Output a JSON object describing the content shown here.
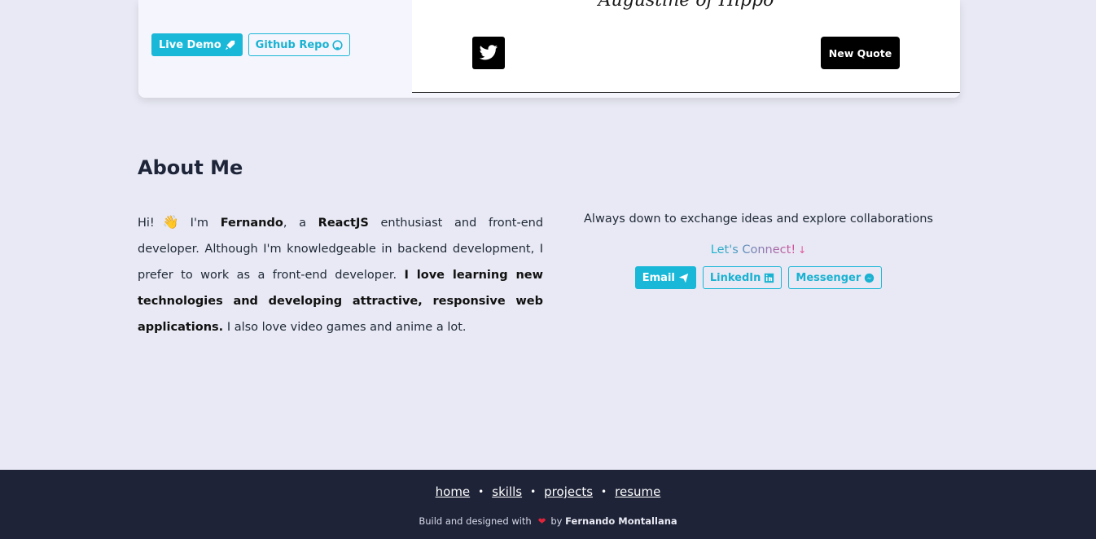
{
  "project_card": {
    "live_demo_label": "Live Demo",
    "github_label": "Github Repo",
    "quote_author": "Augustine of Hippo",
    "new_quote_label": "New Quote"
  },
  "about": {
    "title": "About Me",
    "intro_hi": "Hi!",
    "wave_emoji": "👋",
    "intro_im": "I'm",
    "name": "Fernando",
    "text_a": ", a",
    "reactjs": "ReactJS",
    "text_b": "enthusiast and front-end developer. Although I'm knowledgeable in backend development, I prefer to work as a front-end developer.",
    "bold_passion": "I love learning new technologies and developing attractive, responsive web applications.",
    "text_c": "I also love video games and anime a lot."
  },
  "connect": {
    "tagline": "Always down to exchange ideas and explore collaborations",
    "lets_connect": "Let's Connect!",
    "arrow": "↓",
    "email_label": "Email",
    "linkedin_label": "LinkedIn",
    "messenger_label": "Messenger"
  },
  "footer": {
    "nav": [
      "home",
      "skills",
      "projects",
      "resume"
    ],
    "credit_prefix": "Build and designed with",
    "credit_by": "by",
    "credit_name": "Fernando Montallana"
  },
  "colors": {
    "accent": "#19b8d8",
    "background": "#e8e9f4",
    "footer_bg": "#1e2338",
    "heart": "#e0243a"
  }
}
